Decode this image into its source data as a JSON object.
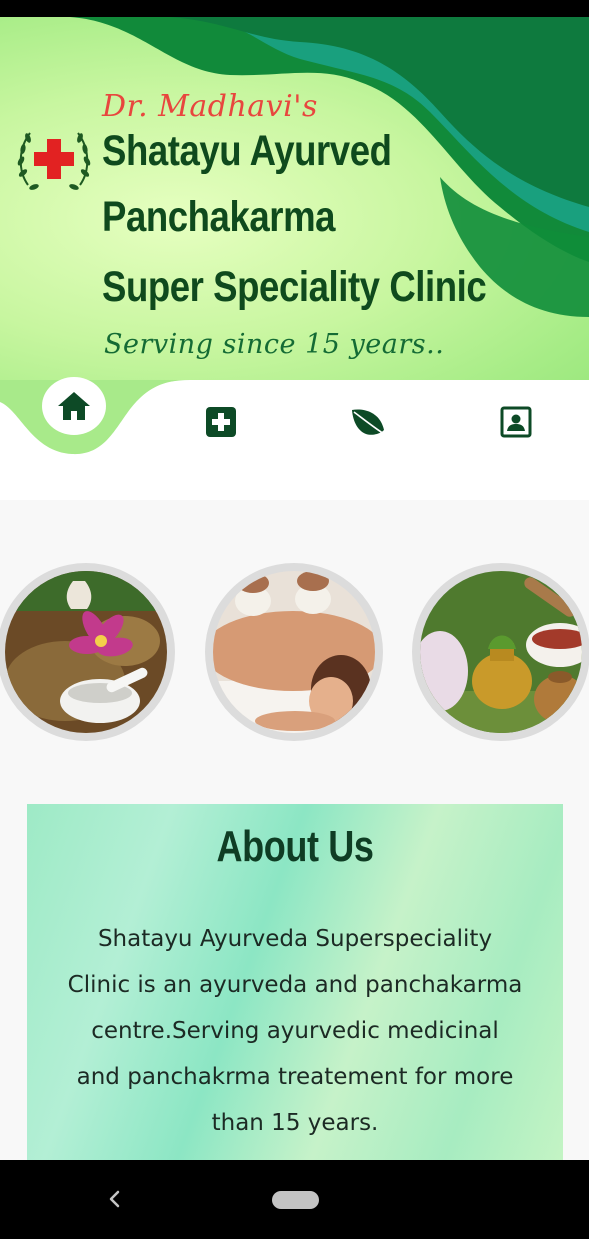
{
  "header": {
    "doctor_name": "Dr. Madhavi's",
    "clinic_lines": [
      "Shatayu Ayurved",
      "Panchakarma",
      "Super Speciality Clinic"
    ],
    "tagline": "Serving since 15 years.."
  },
  "nav": {
    "items": [
      {
        "icon": "home-icon",
        "active": true
      },
      {
        "icon": "medical-cross-icon",
        "active": false
      },
      {
        "icon": "leaf-icon",
        "active": false
      },
      {
        "icon": "contact-card-icon",
        "active": false
      }
    ]
  },
  "gallery": {
    "images": [
      "ayurvedic herbs with flower and mortar",
      "woman receiving herbal bolus massage",
      "herbal pouches and ayurvedic pots"
    ]
  },
  "about": {
    "title": "About Us",
    "text": "Shatayu Ayurveda Superspeciality Clinic is an  ayurveda and panchakarma centre.Serving ayurvedic medicinal and panchakrma treatement for more than 15 years."
  },
  "colors": {
    "brand_dark_green": "#0f4a1d",
    "accent_red": "#e8463e",
    "nav_icon": "#0d4a26"
  }
}
